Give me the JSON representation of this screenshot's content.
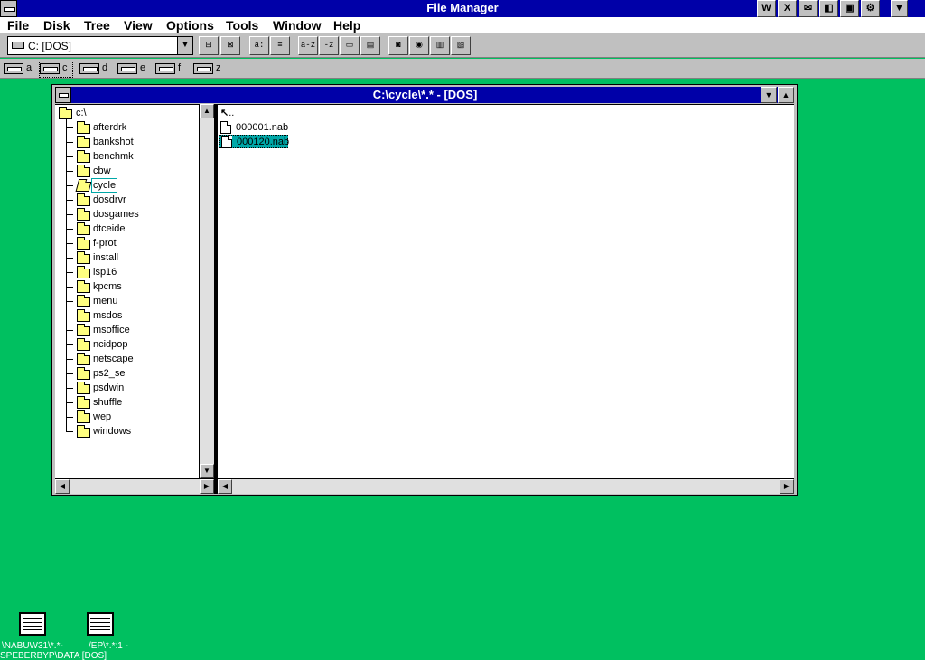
{
  "app": {
    "title": "File Manager"
  },
  "menu": [
    "File",
    "Disk",
    "Tree",
    "View",
    "Options",
    "Tools",
    "Window",
    "Help"
  ],
  "menu_underline": [
    "F",
    "D",
    "T",
    "V",
    "O",
    "l",
    "W",
    "H"
  ],
  "toolbar": {
    "drive_select": "C: [DOS]",
    "buttons": [
      "connect-network-drive",
      "disconnect-network-drive",
      "view-by-name",
      "view-all-details",
      "sort-by-name",
      "sort-by-type",
      "sort-by-size",
      "sort-by-date",
      "new-window",
      "share-as",
      "stop-sharing",
      "copy-disk"
    ]
  },
  "drives": [
    {
      "letter": "a",
      "type": "floppy-drive"
    },
    {
      "letter": "c",
      "type": "hard-drive",
      "selected": true
    },
    {
      "letter": "d",
      "type": "network-drive"
    },
    {
      "letter": "e",
      "type": "network-drive"
    },
    {
      "letter": "f",
      "type": "network-drive"
    },
    {
      "letter": "z",
      "type": "network-drive"
    }
  ],
  "window": {
    "title": "C:\\cycle\\*.* - [DOS]",
    "tree": {
      "root": "c:\\",
      "folders": [
        "afterdrk",
        "bankshot",
        "benchmk",
        "cbw",
        "cycle",
        "dosdrvr",
        "dosgames",
        "dtceide",
        "f-prot",
        "install",
        "isp16",
        "kpcms",
        "menu",
        "msdos",
        "msoffice",
        "ncidpop",
        "netscape",
        "ps2_se",
        "psdwin",
        "shuffle",
        "wep",
        "windows"
      ],
      "selected": "cycle"
    },
    "files": {
      "up": "..",
      "items": [
        "000001.nab",
        "000120.nab"
      ],
      "selected": "000120.nab"
    }
  },
  "minimized": [
    {
      "line1": "\\NABUW31\\*.*-",
      "line2": "SPEBERBYP\\DATA [DOS]"
    },
    {
      "line1": "/EP\\*.*:1 -",
      "line2": ""
    }
  ],
  "colors": {
    "desktop": "#00c060",
    "titlebar": "#0000a8",
    "selection": "#00a8a8"
  }
}
